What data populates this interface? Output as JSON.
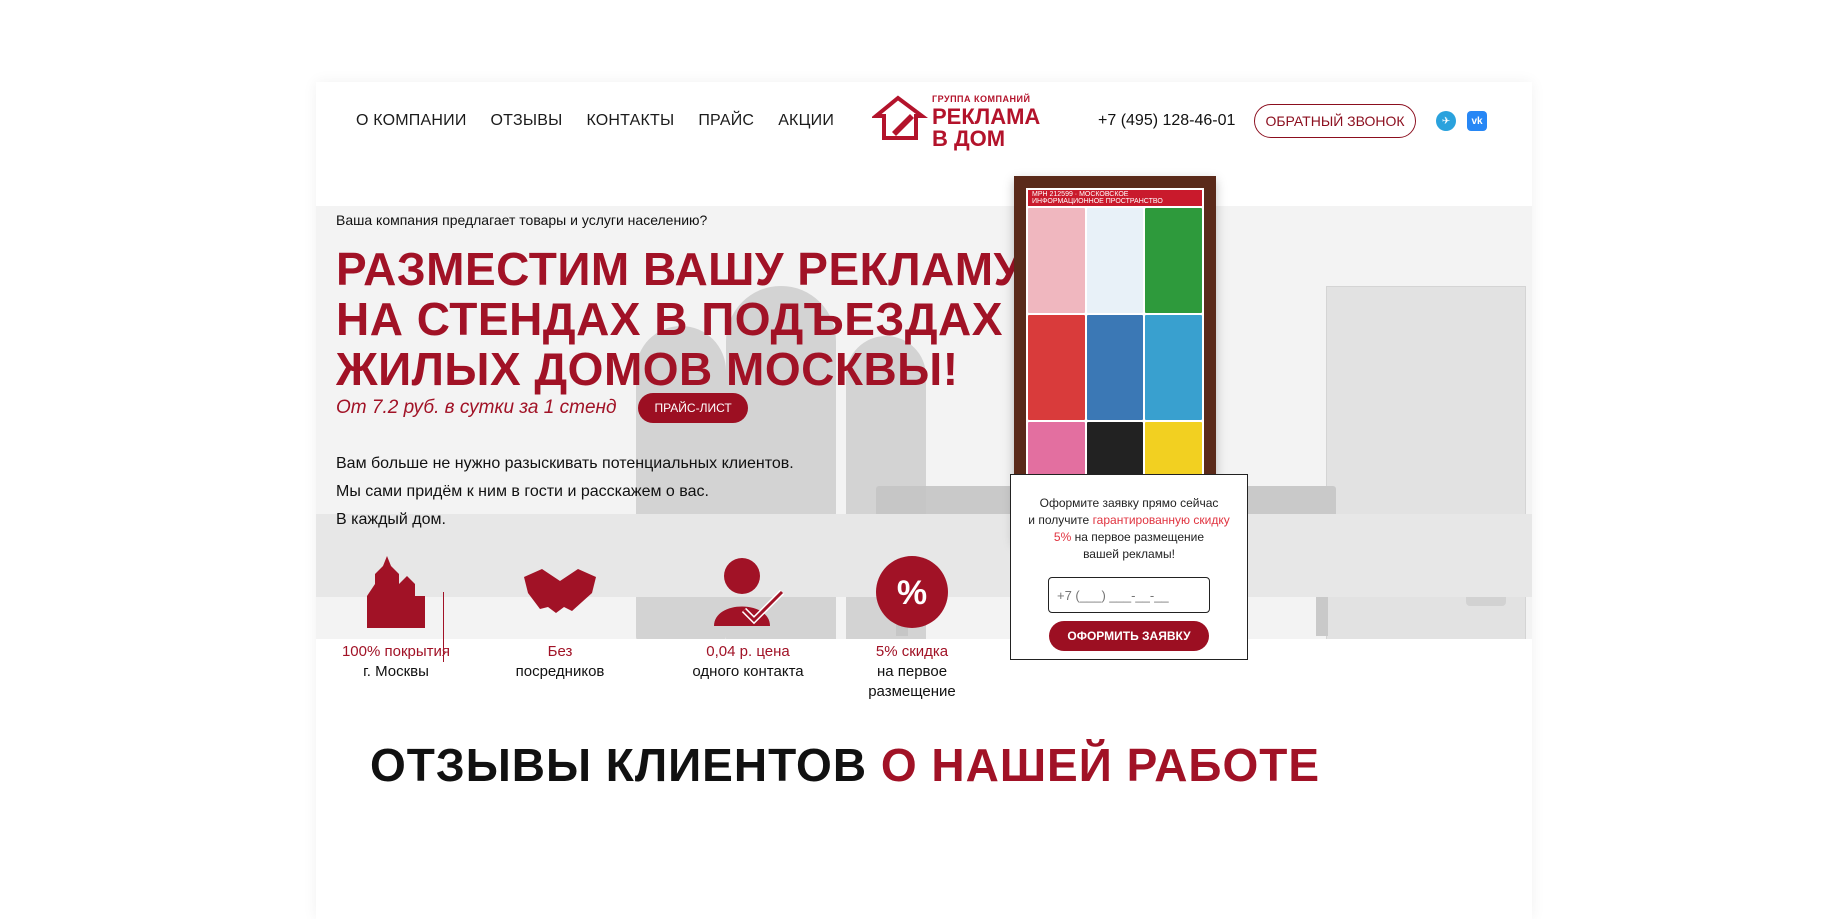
{
  "header": {
    "nav": [
      "О КОМПАНИИ",
      "ОТЗЫВЫ",
      "КОНТАКТЫ",
      "ПРАЙС",
      "АКЦИИ"
    ],
    "logo_small": "ГРУППА КОМПАНИЙ",
    "logo_line1": "РЕКЛАМА",
    "logo_line2": "В ДОМ",
    "phone": "+7 (495) 128-46-01",
    "callback": "ОБРАТНЫЙ ЗВОНОК",
    "social": [
      "telegram-icon",
      "vk-icon"
    ]
  },
  "hero": {
    "subtitle": "Ваша компания предлагает товары и услуги населению?",
    "title": "РАЗМЕСТИМ ВАШУ РЕКЛАМУ НА СТЕНДАХ В ПОДЪЕЗДАХ ЖИЛЫХ ДОМОВ МОСКВЫ!",
    "price": "От 7.2 руб. в сутки за 1 стенд",
    "price_button": "ПРАЙС-ЛИСТ",
    "lead_1": "Вам больше не нужно разыскивать потенциальных клиентов.",
    "lead_2": "Мы сами придём к ним в гости и расскажем о вас.",
    "lead_3": "В каждый дом.",
    "stand_header": "МРН 212599 · МОСКОВСКОЕ ИНФОРМАЦИОННОЕ ПРОСТРАНСТВО"
  },
  "features": [
    {
      "red": "100% покрытия",
      "black": "г. Москвы",
      "icon": "kremlin-icon"
    },
    {
      "red": "Без",
      "black": "посредников",
      "icon": "handshake-icon"
    },
    {
      "red": "0,04 р. цена",
      "black": "одного контакта",
      "icon": "person-check-icon"
    },
    {
      "red": "5% скидка",
      "black": "на первое размещение",
      "icon": "percent-badge-icon"
    }
  ],
  "form": {
    "line1": "Оформите заявку прямо сейчас",
    "line2_pre": "и получите ",
    "line2_hl": "гарантированную скидку",
    "line3_hl": "5%",
    "line3_post": " на первое размещение",
    "line4": "вашей рекламы!",
    "placeholder": "+7 (___) ___-__-__",
    "button": "ОФОРМИТЬ ЗАЯВКУ"
  },
  "reviews": {
    "black": "ОТЗЫВЫ КЛИЕНТОВ",
    "red": "О НАШЕЙ РАБОТЕ"
  },
  "colors": {
    "accent": "#a11226",
    "button": "#9c0f22"
  }
}
